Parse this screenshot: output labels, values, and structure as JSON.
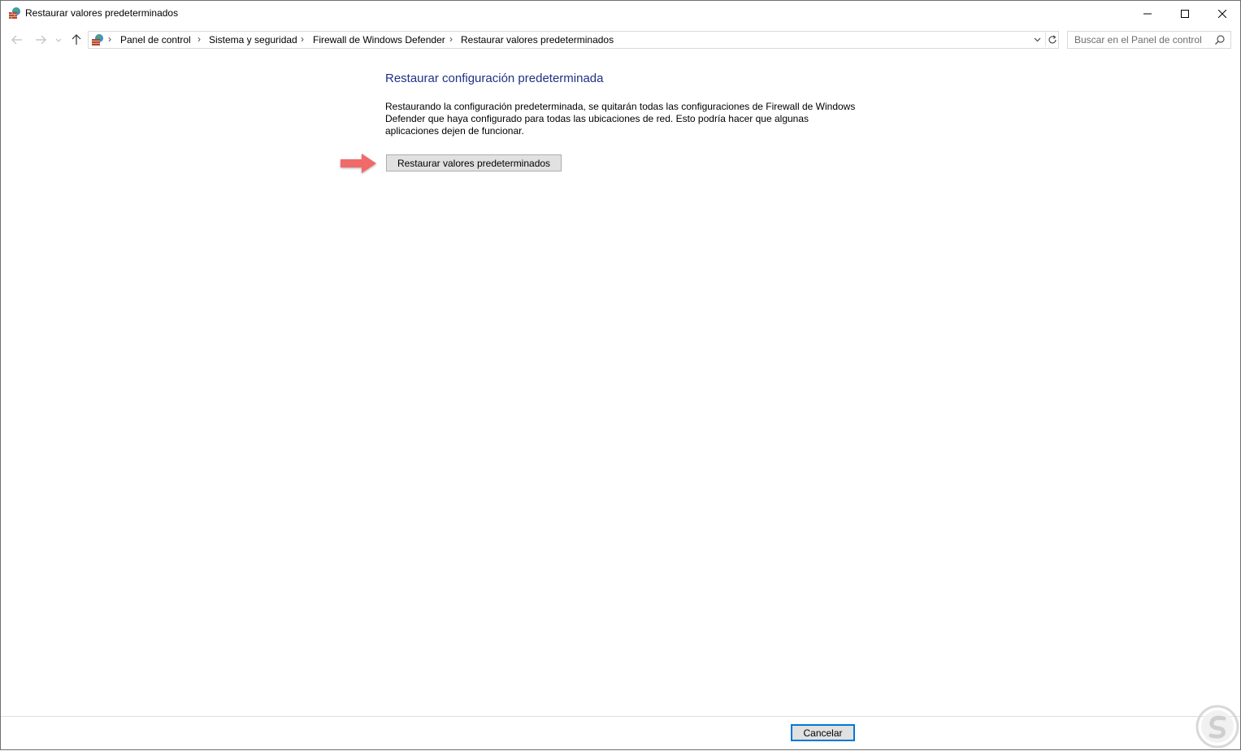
{
  "window": {
    "title": "Restaurar valores predeterminados",
    "icon": "firewall-icon"
  },
  "nav": {
    "back_icon": "arrow-left-icon",
    "forward_icon": "arrow-right-icon",
    "recent_icon": "chevron-down-icon",
    "up_icon": "arrow-up-icon"
  },
  "breadcrumbs": [
    {
      "label": "Panel de control"
    },
    {
      "label": "Sistema y seguridad"
    },
    {
      "label": "Firewall de Windows Defender"
    },
    {
      "label": "Restaurar valores predeterminados"
    }
  ],
  "search": {
    "placeholder": "Buscar en el Panel de control",
    "value": ""
  },
  "content": {
    "title": "Restaurar configuración predeterminada",
    "description": "Restaurando la configuración predeterminada, se quitarán todas las configuraciones de Firewall de Windows Defender que haya configurado para todas las ubicaciones de red. Esto podría hacer que algunas aplicaciones dejen de funcionar.",
    "restore_button": "Restaurar valores predeterminados"
  },
  "footer": {
    "cancel_button": "Cancelar"
  },
  "colors": {
    "title_blue": "#1e3287",
    "arrow": "#f06b6b",
    "focus": "#0078d7"
  }
}
